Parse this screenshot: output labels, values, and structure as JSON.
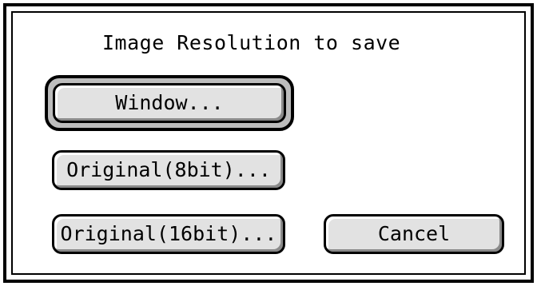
{
  "dialog": {
    "title": "Image Resolution to save",
    "buttons": {
      "window": "Window...",
      "original_8bit": "Original(8bit)...",
      "original_16bit": "Original(16bit)...",
      "cancel": "Cancel"
    },
    "default_button": "window"
  },
  "colors": {
    "background": "#ffffff",
    "border": "#000000",
    "button_face": "#e2e2e2"
  }
}
